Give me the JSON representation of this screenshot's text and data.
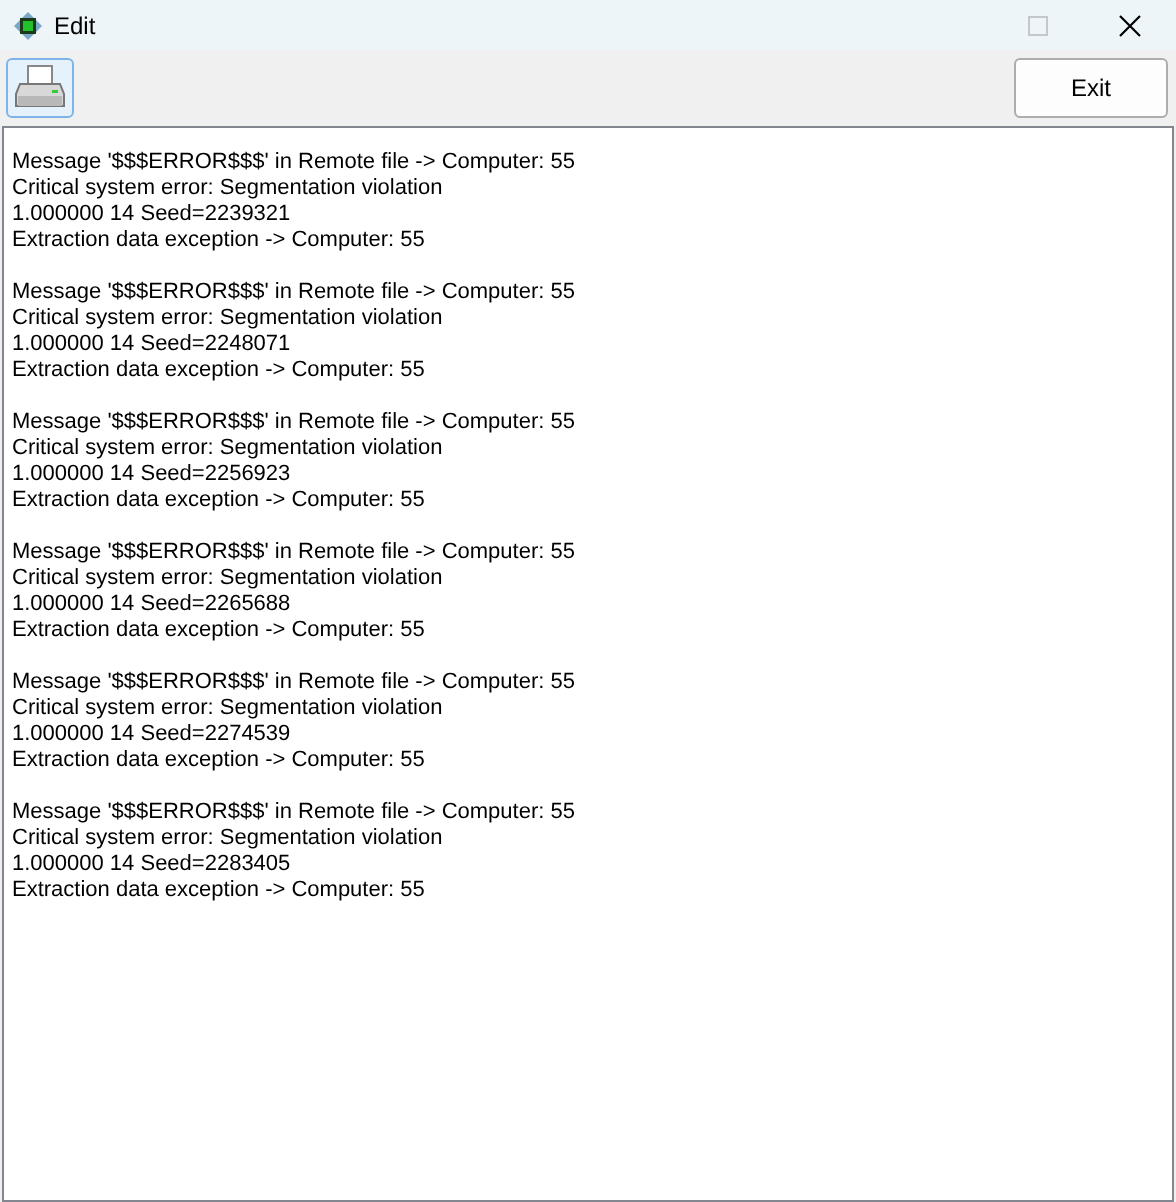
{
  "window": {
    "title": "Edit",
    "maximize_disabled": true
  },
  "toolbar": {
    "exit_button": "Exit"
  },
  "log": [
    {
      "lines": [
        "Message '$$$ERROR$$$' in Remote file -> Computer: 55",
        "Critical system error: Segmentation violation",
        "1.000000 14 Seed=2239321",
        "Extraction data exception -> Computer: 55"
      ]
    },
    {
      "lines": [
        "Message '$$$ERROR$$$' in Remote file -> Computer: 55",
        "Critical system error: Segmentation violation",
        "1.000000 14 Seed=2248071",
        "Extraction data exception -> Computer: 55"
      ]
    },
    {
      "lines": [
        "Message '$$$ERROR$$$' in Remote file -> Computer: 55",
        "Critical system error: Segmentation violation",
        "1.000000 14 Seed=2256923",
        "Extraction data exception -> Computer: 55"
      ]
    },
    {
      "lines": [
        "Message '$$$ERROR$$$' in Remote file -> Computer: 55",
        "Critical system error: Segmentation violation",
        "1.000000 14 Seed=2265688",
        "Extraction data exception -> Computer: 55"
      ]
    },
    {
      "lines": [
        "Message '$$$ERROR$$$' in Remote file -> Computer: 55",
        "Critical system error: Segmentation violation",
        "1.000000 14 Seed=2274539",
        "Extraction data exception -> Computer: 55"
      ]
    },
    {
      "lines": [
        "Message '$$$ERROR$$$' in Remote file -> Computer: 55",
        "Critical system error: Segmentation violation",
        "1.000000 14 Seed=2283405",
        "Extraction data exception -> Computer: 55"
      ]
    }
  ]
}
